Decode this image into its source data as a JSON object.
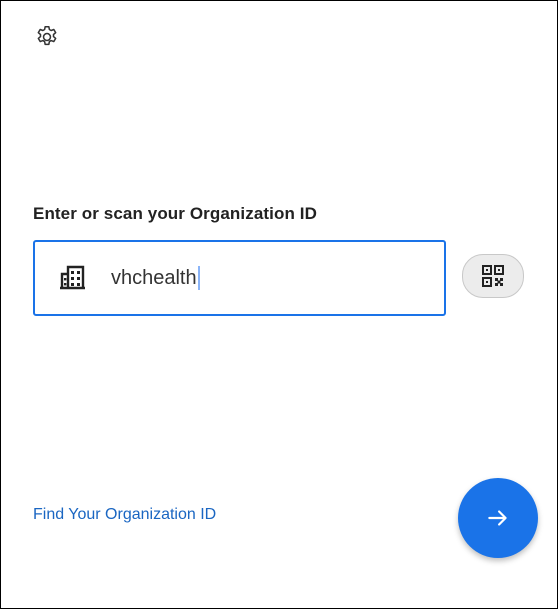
{
  "header": {
    "settings_icon": "gear-icon"
  },
  "org_form": {
    "heading": "Enter or scan your Organization ID",
    "input_value": "vhchealth",
    "input_icon": "building-icon",
    "qr_icon": "qr-code-icon"
  },
  "footer": {
    "find_link": "Find Your Organization ID",
    "next_icon": "arrow-right-icon"
  },
  "colors": {
    "accent": "#1a73e8",
    "link": "#1a66c2",
    "heading": "#222222"
  }
}
